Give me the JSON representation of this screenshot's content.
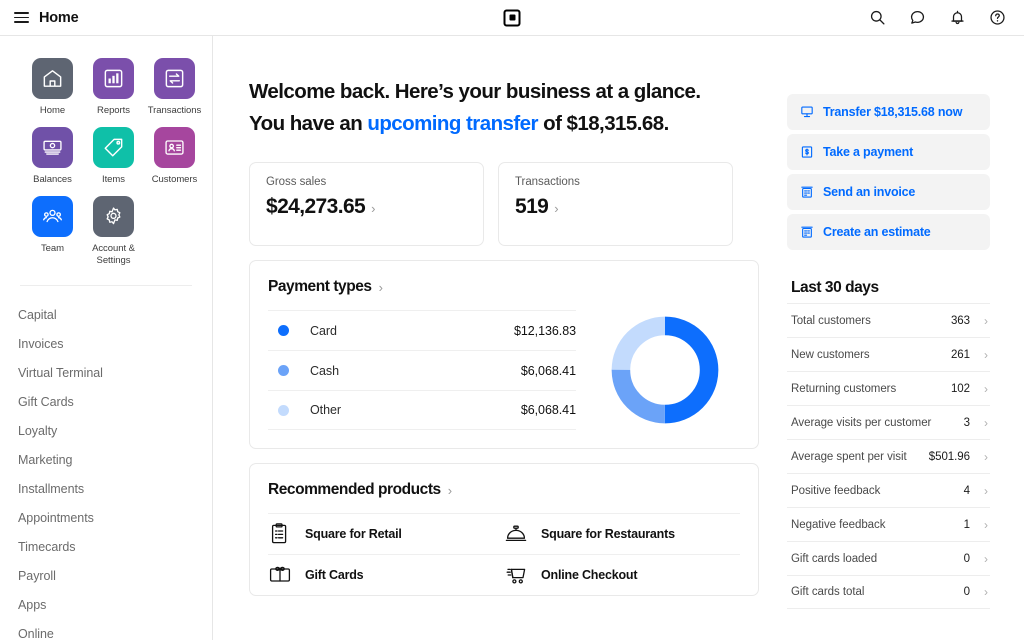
{
  "topbar": {
    "menu_icon": "hamburger-icon",
    "title": "Home",
    "logo": "square-logo",
    "icons": [
      {
        "name": "search-icon"
      },
      {
        "name": "chat-icon"
      },
      {
        "name": "bell-icon"
      },
      {
        "name": "help-icon"
      }
    ]
  },
  "sidebar": {
    "tiles": [
      {
        "label": "Home",
        "icon": "home-icon",
        "color": "#5e6572"
      },
      {
        "label": "Reports",
        "icon": "bar-chart-icon",
        "color": "#7b4fab"
      },
      {
        "label": "Transactions",
        "icon": "exchange-icon",
        "color": "#7b4fab"
      },
      {
        "label": "Balances",
        "icon": "cash-icon",
        "color": "#7051a8"
      },
      {
        "label": "Items",
        "icon": "tag-icon",
        "color": "#0fc0a8"
      },
      {
        "label": "Customers",
        "icon": "contact-card-icon",
        "color": "#a6469e"
      },
      {
        "label": "Team",
        "icon": "people-icon",
        "color": "#0d6efd"
      },
      {
        "label": "Account & Settings",
        "icon": "gear-icon",
        "color": "#5e6572"
      }
    ],
    "nav": [
      "Capital",
      "Invoices",
      "Virtual Terminal",
      "Gift Cards",
      "Loyalty",
      "Marketing",
      "Installments",
      "Appointments",
      "Timecards",
      "Payroll",
      "Apps",
      "Online"
    ]
  },
  "main": {
    "headline_line1": "Welcome back. Here’s your business at a glance.",
    "headline_line2_prefix": "You have an ",
    "headline_link": "upcoming transfer",
    "headline_line2_suffix": " of $18,315.68.",
    "stat_cards": [
      {
        "label": "Gross sales",
        "value": "$24,273.65"
      },
      {
        "label": "Transactions",
        "value": "519"
      }
    ],
    "payment_types": {
      "title": "Payment types",
      "rows": [
        {
          "name": "Card",
          "amount": "$12,136.83",
          "color": "#0d6efd"
        },
        {
          "name": "Cash",
          "amount": "$6,068.41",
          "color": "#6ba3f8"
        },
        {
          "name": "Other",
          "amount": "$6,068.41",
          "color": "#c3dbfd"
        }
      ]
    },
    "recommended": {
      "title": "Recommended products",
      "items": [
        {
          "label": "Square for Retail",
          "icon": "clipboard-icon"
        },
        {
          "label": "Square for Restaurants",
          "icon": "service-bell-icon"
        },
        {
          "label": "Gift Cards",
          "icon": "gift-card-icon"
        },
        {
          "label": "Online Checkout",
          "icon": "shopping-cart-icon"
        }
      ]
    }
  },
  "right_rail": {
    "actions": [
      {
        "label": "Transfer $18,315.68 now",
        "icon": "monitor-icon"
      },
      {
        "label": "Take a payment",
        "icon": "dollar-bill-icon"
      },
      {
        "label": "Send an invoice",
        "icon": "invoice-icon"
      },
      {
        "label": "Create an estimate",
        "icon": "estimate-icon"
      }
    ],
    "section_title": "Last 30 days",
    "kpis": [
      {
        "label": "Total customers",
        "value": "363"
      },
      {
        "label": "New customers",
        "value": "261"
      },
      {
        "label": "Returning customers",
        "value": "102"
      },
      {
        "label": "Average visits per customer",
        "value": "3"
      },
      {
        "label": "Average spent per visit",
        "value": "$501.96"
      },
      {
        "label": "Positive feedback",
        "value": "4"
      },
      {
        "label": "Negative feedback",
        "value": "1"
      },
      {
        "label": "Gift cards loaded",
        "value": "0"
      },
      {
        "label": "Gift cards total",
        "value": "0"
      }
    ]
  },
  "chart_data": {
    "type": "pie",
    "title": "Payment types",
    "categories": [
      "Card",
      "Cash",
      "Other"
    ],
    "values": [
      12136.83,
      6068.41,
      6068.41
    ],
    "percentages": [
      50,
      25,
      25
    ],
    "colors": [
      "#0d6efd",
      "#6ba3f8",
      "#c3dbfd"
    ],
    "donut": true,
    "legend": "left",
    "start_angle_deg": 0,
    "direction": "clockwise"
  },
  "colors": {
    "accent_blue": "#006aff",
    "link_blue": "#0d6efd",
    "border": "#e9e9e9",
    "muted_text": "#6b6b6b"
  }
}
